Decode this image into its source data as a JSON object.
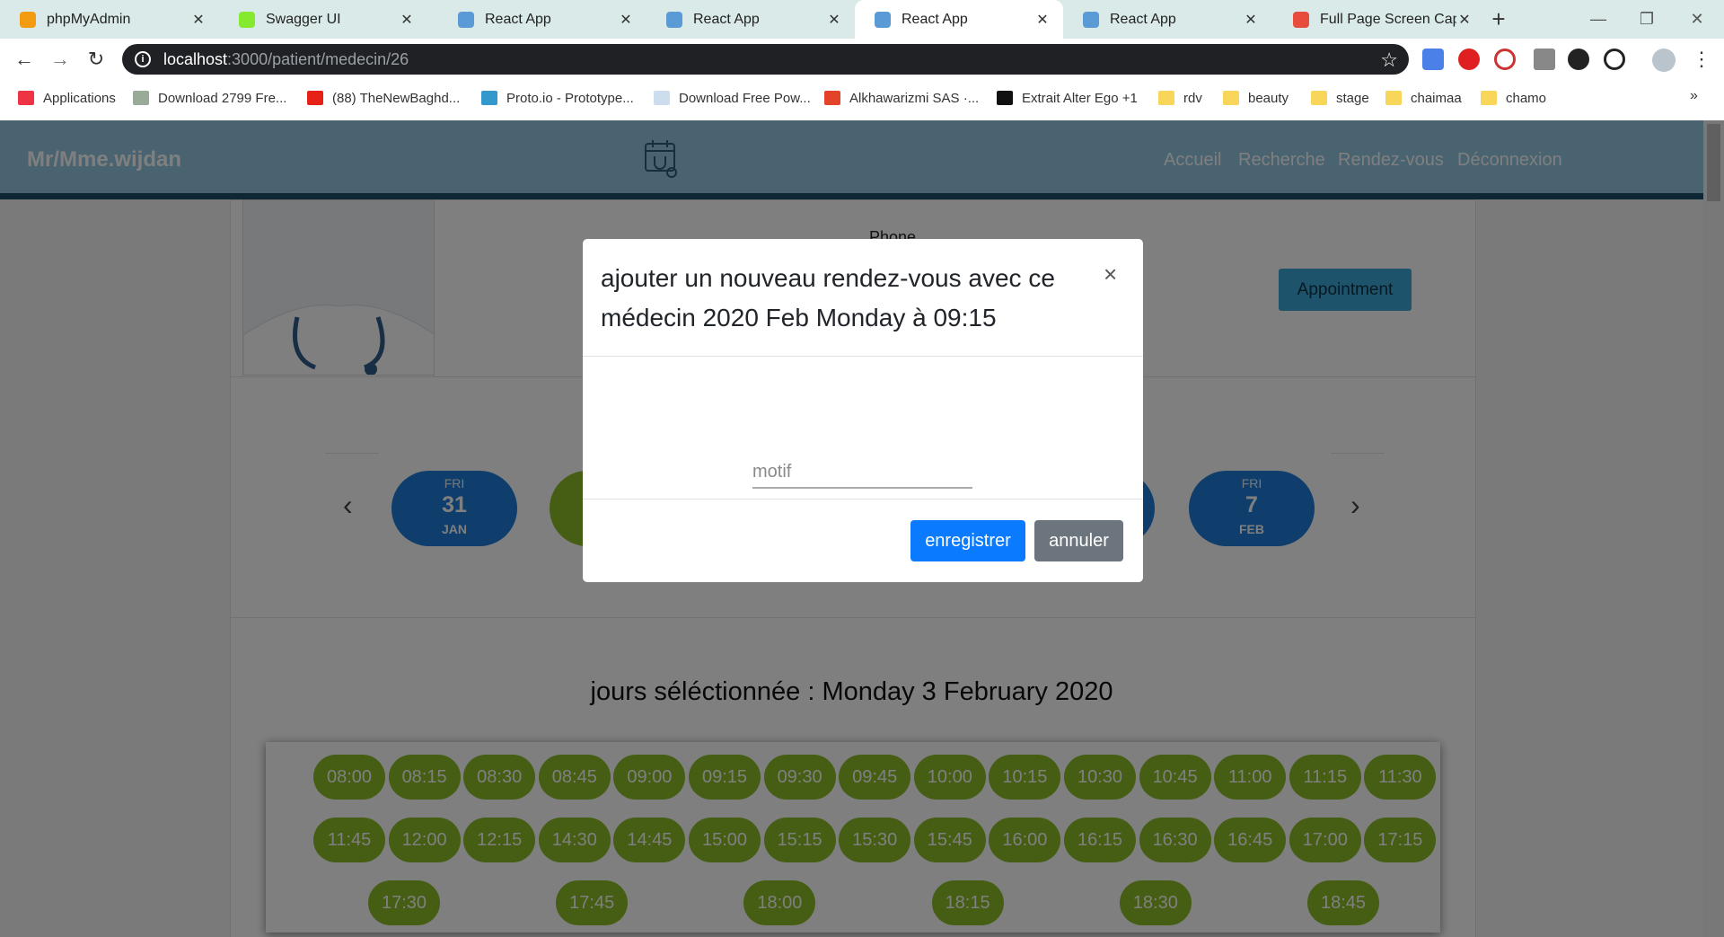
{
  "browser": {
    "tabs": [
      {
        "title": "phpMyAdmin",
        "favicon_color": "#f39c12"
      },
      {
        "title": "Swagger UI",
        "favicon_color": "#85ea2d"
      },
      {
        "title": "React App",
        "favicon_color": "#5b9bd5"
      },
      {
        "title": "React App",
        "favicon_color": "#5b9bd5"
      },
      {
        "title": "React App",
        "favicon_color": "#5b9bd5"
      },
      {
        "title": "React App",
        "favicon_color": "#5b9bd5"
      },
      {
        "title": "Full Page Screen Captu",
        "favicon_color": "#e74c3c"
      }
    ],
    "active_tab_index": 4,
    "tab_close_glyph": "✕",
    "new_tab_glyph": "+",
    "url_host": "localhost",
    "url_path": ":3000/patient/medecin/26",
    "bookmarks": [
      {
        "label": "Applications",
        "icon": "apps-grid-icon"
      },
      {
        "label": "Download 2799 Fre...",
        "icon": "csv-icon"
      },
      {
        "label": "(88) TheNewBaghd...",
        "icon": "youtube-icon"
      },
      {
        "label": "Proto.io - Prototype...",
        "icon": "info-icon"
      },
      {
        "label": "Download Free Pow...",
        "icon": "page-icon"
      },
      {
        "label": "Alkhawarizmi SAS ·...",
        "icon": "gitlab-icon"
      },
      {
        "label": "Extrait Alter Ego +1",
        "icon": "e-icon"
      },
      {
        "label": "rdv",
        "icon": "folder-icon"
      },
      {
        "label": "beauty",
        "icon": "folder-icon"
      },
      {
        "label": "stage",
        "icon": "folder-icon"
      },
      {
        "label": "chaimaa",
        "icon": "folder-icon"
      },
      {
        "label": "chamo",
        "icon": "folder-icon"
      }
    ],
    "bookmarks_overflow": "»"
  },
  "app": {
    "brand": "Mr/Mme.wijdan",
    "nav": [
      "Accueil",
      "Recherche",
      "Rendez-vous",
      "Déconnexion"
    ],
    "nav_color": "#92c7e3",
    "accent_color": "#1d4e6b"
  },
  "doctor": {
    "phone_label": "Phone",
    "appointment_button": "Appointment"
  },
  "days": [
    {
      "dow": "FRI",
      "num": "31",
      "month": "JAN",
      "color": "#1f7ad8"
    },
    {
      "dow": "FRI",
      "num": "7",
      "month": "FEB",
      "color": "#1f7ad8"
    }
  ],
  "selected_day_text": "jours séléctionnée : Monday 3 February 2020",
  "slots": [
    "08:00",
    "08:15",
    "08:30",
    "08:45",
    "09:00",
    "09:15",
    "09:30",
    "09:45",
    "10:00",
    "10:15",
    "10:30",
    "10:45",
    "11:00",
    "11:15",
    "11:30",
    "11:45",
    "12:00",
    "12:15",
    "14:30",
    "14:45",
    "15:00",
    "15:15",
    "15:30",
    "15:45",
    "16:00",
    "16:15",
    "16:30",
    "16:45",
    "17:00",
    "17:15",
    "17:30",
    "17:45",
    "18:00",
    "18:15",
    "18:30",
    "18:45"
  ],
  "slot_color": "#8bbd28",
  "modal": {
    "title": "ajouter un nouveau rendez-vous avec ce médecin 2020 Feb Monday à 09:15",
    "close_glyph": "×",
    "motif_placeholder": "motif",
    "motif_value": "",
    "save_label": "enregistrer",
    "cancel_label": "annuler",
    "save_color": "#0a7bff",
    "cancel_color": "#6c757d"
  }
}
